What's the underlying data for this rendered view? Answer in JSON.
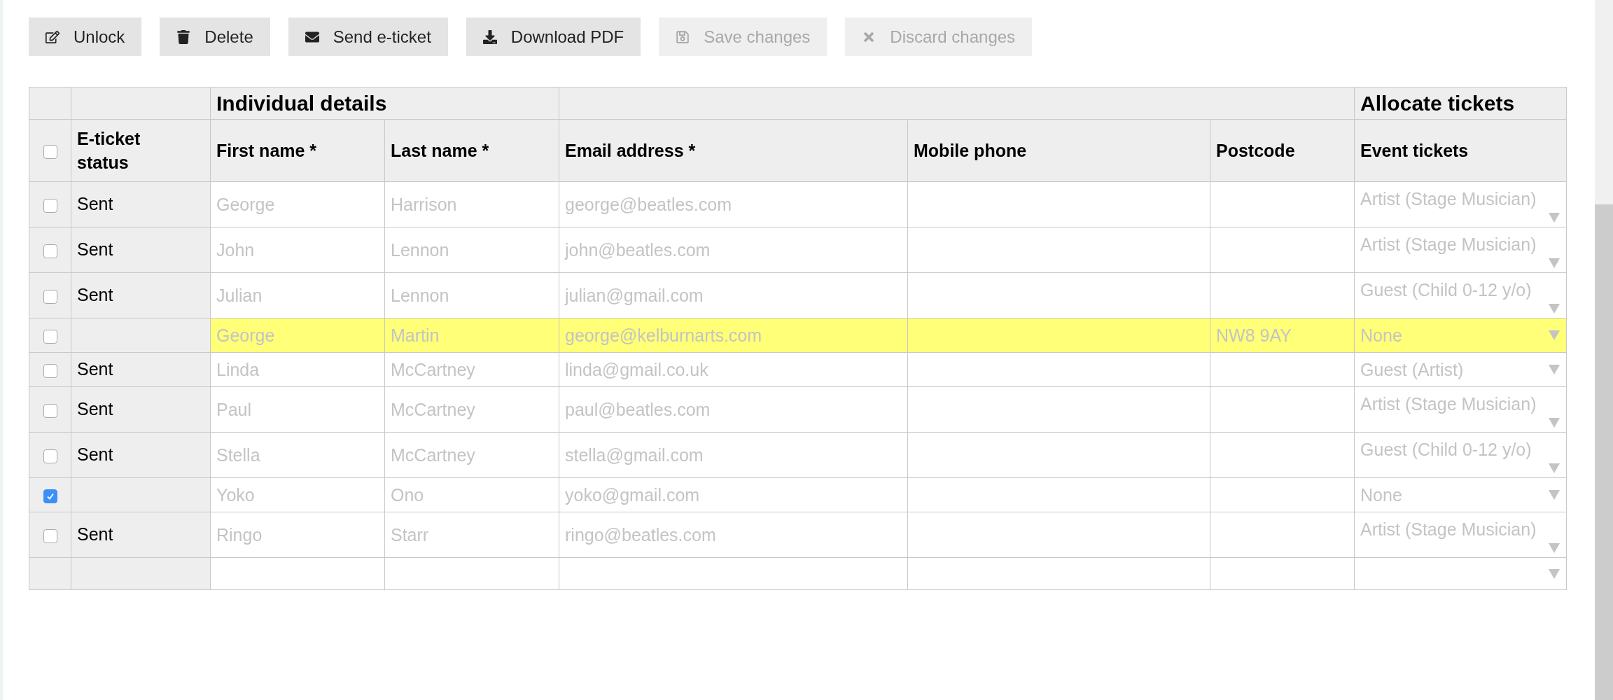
{
  "toolbar": [
    {
      "label": "Unlock",
      "disabled": false
    },
    {
      "label": "Delete",
      "disabled": false
    },
    {
      "label": "Send e-ticket",
      "disabled": false
    },
    {
      "label": "Download PDF",
      "disabled": false
    },
    {
      "label": "Save changes",
      "disabled": true
    },
    {
      "label": "Discard changes",
      "disabled": true
    }
  ],
  "table": {
    "groups": {
      "details": "Individual details",
      "allocate": "Allocate tickets"
    },
    "select_all": {
      "checked": false
    },
    "columns": {
      "status": "E-ticket status",
      "first_name": "First name *",
      "last_name": "Last name *",
      "email": "Email address *",
      "mobile": "Mobile phone",
      "postcode": "Postcode",
      "tickets": "Event tickets"
    },
    "rows": [
      {
        "selected": false,
        "highlighted": false,
        "status": "Sent",
        "first_name": "George",
        "last_name": "Harrison",
        "email": "george@beatles.com",
        "ticket": "Artist (Stage Musician)"
      },
      {
        "selected": false,
        "highlighted": false,
        "status": "Sent",
        "first_name": "John",
        "last_name": "Lennon",
        "email": "john@beatles.com",
        "ticket": "Artist (Stage Musician)"
      },
      {
        "selected": false,
        "highlighted": false,
        "status": "Sent",
        "first_name": "Julian",
        "last_name": "Lennon",
        "email": "julian@gmail.com",
        "ticket": "Guest (Child 0-12 y/o)"
      },
      {
        "selected": false,
        "highlighted": true,
        "first_name": "George",
        "last_name": "Martin",
        "email": "george@kelburnarts.com",
        "postcode": "NW8 9AY",
        "ticket": "None"
      },
      {
        "selected": false,
        "highlighted": false,
        "status": "Sent",
        "first_name": "Linda",
        "last_name": "McCartney",
        "email": "linda@gmail.co.uk",
        "ticket": "Guest (Artist)"
      },
      {
        "selected": false,
        "highlighted": false,
        "status": "Sent",
        "first_name": "Paul",
        "last_name": "McCartney",
        "email": "paul@beatles.com",
        "ticket": "Artist (Stage Musician)"
      },
      {
        "selected": false,
        "highlighted": false,
        "status": "Sent",
        "first_name": "Stella",
        "last_name": "McCartney",
        "email": "stella@gmail.com",
        "ticket": "Guest (Child 0-12 y/o)"
      },
      {
        "selected": true,
        "highlighted": false,
        "first_name": "Yoko",
        "last_name": "Ono",
        "email": "yoko@gmail.com",
        "ticket": "None"
      },
      {
        "selected": false,
        "highlighted": false,
        "status": "Sent",
        "first_name": "Ringo",
        "last_name": "Starr",
        "email": "ringo@beatles.com",
        "ticket": "Artist (Stage Musician)"
      }
    ],
    "new_row": true
  }
}
